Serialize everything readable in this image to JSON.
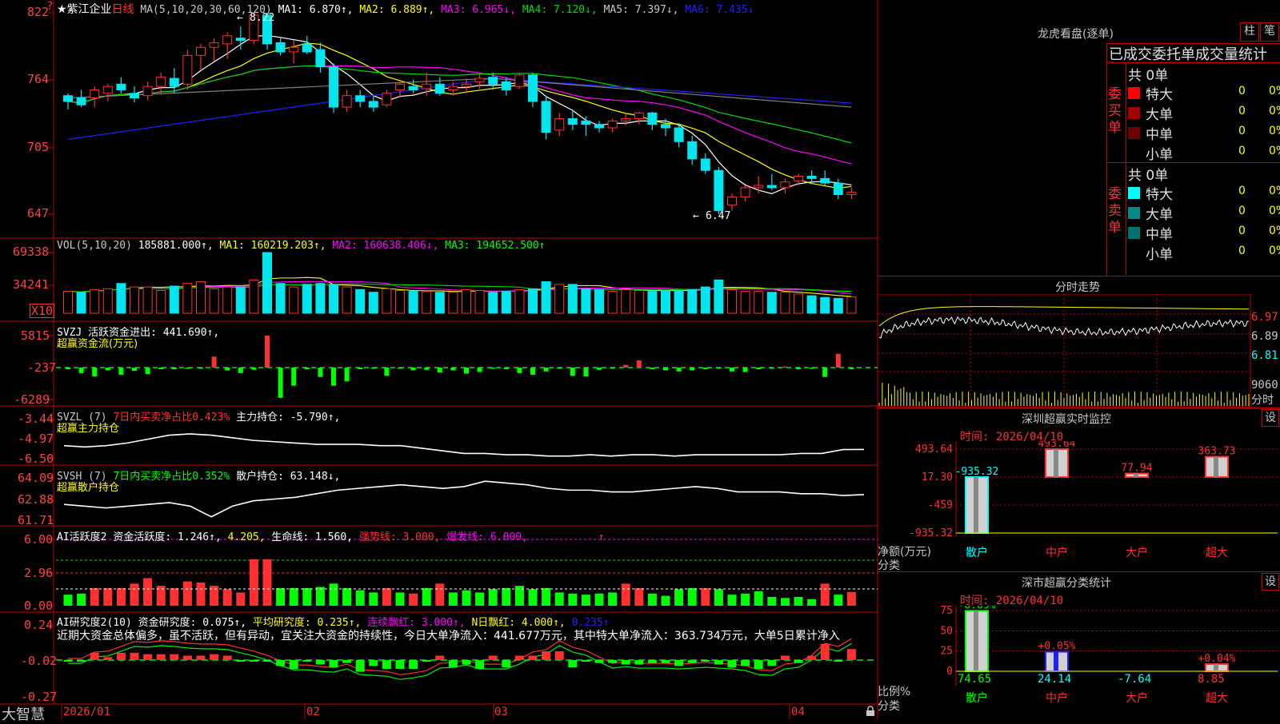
{
  "app": {
    "brand": "大智慧",
    "lock_icon": "lock-icon"
  },
  "colors": {
    "up": "#ff3030",
    "down": "#00e5ee",
    "frame": "#c00000",
    "ma1": "#ffffff",
    "ma2": "#ffff00",
    "ma3": "#ff00ff",
    "ma4": "#00dd00",
    "ma5": "#808080",
    "ma6": "#2020ff",
    "green": "#00ff00"
  },
  "price_panel": {
    "stock_name": "★紫江企业",
    "period": "日线",
    "ma_header": "MA(5,10,20,30,60,120)",
    "ma1": "MA1: 6.870↑,",
    "ma2": "MA2: 6.889↑,",
    "ma3": "MA3: 6.965↓,",
    "ma4": "MA4: 7.120↓,",
    "ma5": "MA5: 7.397↓,",
    "ma6": "MA6: 7.435↓",
    "y_ticks": [
      "822",
      "764",
      "705",
      "647"
    ],
    "high_label": "8.22",
    "low_label": "6.47",
    "marker": "?"
  },
  "vol_panel": {
    "header": "VOL(5,10,20)",
    "vol": "185881.000↑,",
    "ma1": "MA1: 160219.203↑,",
    "ma2": "MA2: 160638.406↓,",
    "ma3": "MA3: 194652.500↑",
    "y_ticks": [
      "69338",
      "34241"
    ],
    "unit": "X10"
  },
  "svzj_panel": {
    "header": "SVZJ  活跃资金进出: 441.690↑,",
    "sub": "超赢资金流(万元)",
    "y_ticks": [
      "5815",
      "-237",
      "-6289"
    ]
  },
  "svzl_panel": {
    "title": "SVZL (7)",
    "ratio": "7日内买卖净占比0.423%",
    "value": "主力持仓: -5.790↑,",
    "sub": "超赢主力持仓",
    "y_ticks": [
      "-3.44",
      "-4.97",
      "-6.50"
    ]
  },
  "svsh_panel": {
    "title": "SVSH (7)",
    "ratio": "7日内买卖净占比0.352%",
    "value": "散户持仓: 63.148↓,",
    "sub": "超赢散户持仓",
    "y_ticks": [
      "64.09",
      "62.88",
      "61.71"
    ]
  },
  "ai_active_panel": {
    "title": "AI活跃度2",
    "a1": "资金活跃度: 1.246↑,",
    "a2": "4.205,",
    "a3": "生命线: 1.560,",
    "a4": "强势线: 3.000,",
    "a5": "爆发线: 6.000,",
    "a6": "↑",
    "y_ticks": [
      "6.00",
      "2.96",
      "0.00"
    ]
  },
  "ai_research_panel": {
    "title": "AI研究度2(10)",
    "r1": "资金研究度: 0.075↑,",
    "r2": "平均研究度: 0.235↑,",
    "r3": "连续飘红: 3.000↑,",
    "r4": "N日飘红: 4.000↑,",
    "r5": "0.235↑",
    "commentary": "近期大资金总体偏多，虽不活跃，但有异动，宜关注大资金的持续性，今日大单净流入：441.677万元，其中特大单净流入：363.734万元，大单5日累计净入",
    "y_ticks": [
      "0.24",
      "-0.02",
      "-0.27"
    ]
  },
  "x_axis": {
    "labels": [
      "2026/01",
      "02",
      "03",
      "04"
    ]
  },
  "right_panel": {
    "title": "龙虎看盘(逐单)",
    "tab_bar": "柱",
    "tab_stroke": "笔",
    "stats_title": "已成交委托单成交量统计",
    "buy": {
      "side_label": [
        "委",
        "买",
        "单"
      ],
      "total": "共 0单",
      "rows": [
        {
          "label": "特大",
          "value": "0",
          "pct": "0%",
          "color": "#ff0000"
        },
        {
          "label": "大单",
          "value": "0",
          "pct": "0%",
          "color": "#a00000"
        },
        {
          "label": "中单",
          "value": "0",
          "pct": "0%",
          "color": "#700000"
        },
        {
          "label": "小单",
          "value": "0",
          "pct": "0%",
          "color": "#000000"
        }
      ]
    },
    "sell": {
      "side_label": [
        "委",
        "卖",
        "单"
      ],
      "total": "共 0单",
      "rows": [
        {
          "label": "特大",
          "value": "0",
          "pct": "0%",
          "color": "#00ffff"
        },
        {
          "label": "大单",
          "value": "0",
          "pct": "0%",
          "color": "#008b8b"
        },
        {
          "label": "中单",
          "value": "0",
          "pct": "0%",
          "color": "#007070"
        },
        {
          "label": "小单",
          "value": "0",
          "pct": "0%",
          "color": "#000000"
        }
      ]
    },
    "intraday": {
      "title": "分时走势",
      "prices": [
        "6.97",
        "6.89",
        "6.81"
      ],
      "vol_max": "9060",
      "vol_unit": "分时"
    },
    "monitor": {
      "title": "深圳超赢实时监控",
      "settings": "设",
      "time": "时间: 2026/04/10",
      "y_ticks": [
        "493.64",
        "17.30",
        "-459",
        "-935.32"
      ],
      "y_label1": "净额(万元)",
      "y_label2": "分类",
      "categories": [
        "散户",
        "中户",
        "大户",
        "超大"
      ],
      "values": [
        -935.32,
        493.64,
        77.94,
        363.73
      ],
      "value_labels": [
        "-935.32",
        "493.64",
        "77.94",
        "363.73"
      ]
    },
    "classify": {
      "title": "深市超赢分类统计",
      "settings": "设",
      "time": "时间: 2026/04/10",
      "y_ticks": [
        "75",
        "50",
        "25",
        "0"
      ],
      "y_label1": "比例%",
      "y_label2": "分类",
      "categories": [
        "散户",
        "中户",
        "大户",
        "超大"
      ],
      "values": [
        74.65,
        24.14,
        -7.64,
        8.85
      ],
      "changes": [
        "-0.09%",
        "+0.05%",
        "",
        "+0.04%"
      ],
      "value_labels": [
        "74.65",
        "24.14",
        "-7.64",
        "8.85"
      ]
    }
  },
  "chart_data": [
    {
      "type": "candlestick",
      "title": "★紫江企业 日线",
      "note": "daily OHLC (yuan), approximate read from chart; 60 sessions Jan–Apr 2026",
      "ylim": [
        6.4,
        8.3
      ],
      "ohlc": [
        [
          7.5,
          7.52,
          7.38,
          7.45
        ],
        [
          7.48,
          7.55,
          7.4,
          7.42
        ],
        [
          7.48,
          7.58,
          7.4,
          7.55
        ],
        [
          7.52,
          7.6,
          7.45,
          7.58
        ],
        [
          7.6,
          7.66,
          7.52,
          7.55
        ],
        [
          7.52,
          7.58,
          7.44,
          7.48
        ],
        [
          7.5,
          7.62,
          7.46,
          7.58
        ],
        [
          7.58,
          7.7,
          7.52,
          7.66
        ],
        [
          7.65,
          7.74,
          7.52,
          7.58
        ],
        [
          7.6,
          7.9,
          7.55,
          7.85
        ],
        [
          7.85,
          7.95,
          7.72,
          7.92
        ],
        [
          7.92,
          8.0,
          7.8,
          7.96
        ],
        [
          7.95,
          8.05,
          7.82,
          8.02
        ],
        [
          8.0,
          8.1,
          7.9,
          7.98
        ],
        [
          7.98,
          8.22,
          7.95,
          8.2
        ],
        [
          8.2,
          8.22,
          7.9,
          7.95
        ],
        [
          7.96,
          8.0,
          7.85,
          7.88
        ],
        [
          7.88,
          7.98,
          7.78,
          7.92
        ],
        [
          7.95,
          8.02,
          7.86,
          7.88
        ],
        [
          7.9,
          7.96,
          7.7,
          7.75
        ],
        [
          7.75,
          7.78,
          7.35,
          7.4
        ],
        [
          7.4,
          7.55,
          7.36,
          7.5
        ],
        [
          7.5,
          7.55,
          7.4,
          7.45
        ],
        [
          7.45,
          7.5,
          7.36,
          7.4
        ],
        [
          7.42,
          7.55,
          7.4,
          7.52
        ],
        [
          7.55,
          7.62,
          7.48,
          7.6
        ],
        [
          7.58,
          7.64,
          7.52,
          7.55
        ],
        [
          7.56,
          7.7,
          7.5,
          7.6
        ],
        [
          7.6,
          7.66,
          7.5,
          7.52
        ],
        [
          7.55,
          7.62,
          7.5,
          7.58
        ],
        [
          7.58,
          7.65,
          7.52,
          7.6
        ],
        [
          7.62,
          7.7,
          7.56,
          7.65
        ],
        [
          7.66,
          7.7,
          7.55,
          7.6
        ],
        [
          7.62,
          7.66,
          7.5,
          7.55
        ],
        [
          7.58,
          7.7,
          7.56,
          7.68
        ],
        [
          7.68,
          7.7,
          7.4,
          7.45
        ],
        [
          7.45,
          7.5,
          7.12,
          7.18
        ],
        [
          7.2,
          7.35,
          7.15,
          7.3
        ],
        [
          7.3,
          7.38,
          7.2,
          7.25
        ],
        [
          7.28,
          7.32,
          7.15,
          7.25
        ],
        [
          7.25,
          7.28,
          7.18,
          7.22
        ],
        [
          7.22,
          7.3,
          7.18,
          7.28
        ],
        [
          7.28,
          7.35,
          7.24,
          7.3
        ],
        [
          7.3,
          7.36,
          7.25,
          7.35
        ],
        [
          7.35,
          7.36,
          7.2,
          7.25
        ],
        [
          7.25,
          7.3,
          7.15,
          7.22
        ],
        [
          7.22,
          7.26,
          7.05,
          7.1
        ],
        [
          7.1,
          7.15,
          6.9,
          6.95
        ],
        [
          6.95,
          7.0,
          6.82,
          6.85
        ],
        [
          6.85,
          6.88,
          6.47,
          6.5
        ],
        [
          6.55,
          6.65,
          6.5,
          6.62
        ],
        [
          6.62,
          6.72,
          6.58,
          6.7
        ],
        [
          6.7,
          6.8,
          6.65,
          6.72
        ],
        [
          6.72,
          6.82,
          6.68,
          6.7
        ],
        [
          6.7,
          6.78,
          6.65,
          6.75
        ],
        [
          6.76,
          6.82,
          6.72,
          6.8
        ],
        [
          6.8,
          6.85,
          6.74,
          6.78
        ],
        [
          6.78,
          6.85,
          6.72,
          6.74
        ],
        [
          6.74,
          6.78,
          6.6,
          6.64
        ],
        [
          6.64,
          6.7,
          6.6,
          6.66
        ]
      ]
    },
    {
      "type": "bar",
      "title": "VOL(5,10,20)",
      "note": "volume in units of 10 (X10), approximate; direction per session",
      "ylim": [
        0,
        80000
      ],
      "values": [
        25000,
        24000,
        27000,
        28000,
        34000,
        30000,
        30000,
        26000,
        31000,
        34000,
        36000,
        28000,
        30000,
        30000,
        38000,
        69338,
        34000,
        30000,
        33000,
        34000,
        33000,
        30000,
        27000,
        24000,
        28000,
        26000,
        25000,
        25000,
        24000,
        24000,
        27000,
        26000,
        24000,
        25000,
        27000,
        28000,
        36000,
        33000,
        33000,
        28000,
        27000,
        25000,
        27000,
        26000,
        25000,
        26000,
        26000,
        27000,
        30000,
        38000,
        27000,
        25000,
        25000,
        24000,
        24000,
        22000,
        20000,
        18000,
        17000,
        18588
      ],
      "up": [
        true,
        false,
        true,
        true,
        false,
        true,
        true,
        true,
        false,
        true,
        true,
        true,
        true,
        false,
        true,
        false,
        false,
        true,
        false,
        false,
        false,
        true,
        false,
        false,
        true,
        true,
        false,
        true,
        false,
        true,
        true,
        true,
        false,
        false,
        true,
        false,
        false,
        true,
        false,
        false,
        false,
        true,
        true,
        true,
        false,
        false,
        false,
        false,
        false,
        false,
        true,
        true,
        true,
        false,
        true,
        true,
        false,
        false,
        false,
        true
      ]
    },
    {
      "type": "bar",
      "title": "SVZJ 超赢资金流(万元)",
      "note": "net active money flow per session (万元), approximate",
      "ylim": [
        -6289,
        5815
      ],
      "values": [
        -300,
        -1000,
        -1600,
        -500,
        -1300,
        -600,
        -1200,
        -300,
        -300,
        -200,
        -200,
        2000,
        -500,
        -1000,
        -400,
        5815,
        -5500,
        -3300,
        -300,
        -1700,
        -3300,
        -2500,
        -300,
        -200,
        -1500,
        -200,
        -500,
        -400,
        -900,
        -500,
        -1100,
        -800,
        -200,
        -300,
        -1000,
        -1300,
        -700,
        -200,
        -1500,
        -1600,
        -400,
        -200,
        500,
        1300,
        -300,
        -500,
        -700,
        -500,
        -300,
        -200,
        -700,
        -800,
        -300,
        -200,
        200,
        -300,
        -200,
        -1700,
        2500,
        -300
      ]
    },
    {
      "type": "line",
      "title": "SVZL 超赢主力持仓",
      "note": "main-force position line, approximate",
      "ylim": [
        -6.5,
        -3.44
      ],
      "values": [
        -5.5,
        -5.6,
        -5.5,
        -5.3,
        -5.0,
        -4.7,
        -4.6,
        -4.7,
        -4.9,
        -5.1,
        -5.2,
        -5.3,
        -5.4,
        -5.4,
        -5.4,
        -5.5,
        -5.5,
        -5.7,
        -5.9,
        -6.1,
        -6.1,
        -6.2,
        -6.2,
        -6.3,
        -6.3,
        -6.2,
        -6.3,
        -6.2,
        -6.2,
        -6.3,
        -6.2,
        -6.2,
        -6.2,
        -6.2,
        -6.2,
        -6.1,
        -6.1,
        -5.8,
        -5.79
      ]
    },
    {
      "type": "line",
      "title": "SVSH 超赢散户持仓",
      "note": "retail position line, approximate",
      "ylim": [
        61.71,
        64.09
      ],
      "values": [
        62.6,
        62.5,
        62.4,
        62.5,
        62.6,
        62.7,
        62.5,
        61.9,
        62.5,
        62.8,
        62.9,
        63.0,
        63.2,
        63.4,
        63.5,
        63.6,
        63.7,
        63.6,
        63.5,
        63.6,
        63.9,
        63.8,
        63.7,
        63.5,
        63.4,
        63.4,
        63.3,
        63.3,
        63.4,
        63.5,
        63.6,
        63.5,
        63.3,
        63.3,
        63.3,
        63.2,
        63.2,
        63.1,
        63.148
      ]
    },
    {
      "type": "bar",
      "title": "AI活跃度2",
      "note": "fund activity per session, approximate",
      "ylim": [
        0,
        6.0
      ],
      "values": [
        1.0,
        1.1,
        1.6,
        1.6,
        1.6,
        2.0,
        2.5,
        1.8,
        1.6,
        2.2,
        2.1,
        1.8,
        1.5,
        1.2,
        4.2,
        4.2,
        1.6,
        1.6,
        1.6,
        1.7,
        2.0,
        1.6,
        1.4,
        1.2,
        1.6,
        1.2,
        1.1,
        1.6,
        2.0,
        1.2,
        1.4,
        1.2,
        1.5,
        1.6,
        1.8,
        1.5,
        1.6,
        1.2,
        1.1,
        1.0,
        1.1,
        1.2,
        2.0,
        1.6,
        1.1,
        0.9,
        1.5,
        1.6,
        1.6,
        1.5,
        1.0,
        1.1,
        1.3,
        0.8,
        0.7,
        0.8,
        0.6,
        2.0,
        1.0,
        1.246
      ],
      "up": [
        false,
        false,
        true,
        true,
        true,
        true,
        true,
        true,
        true,
        true,
        true,
        true,
        true,
        true,
        true,
        true,
        false,
        false,
        false,
        false,
        false,
        false,
        false,
        false,
        true,
        false,
        true,
        false,
        true,
        false,
        false,
        false,
        false,
        false,
        false,
        false,
        false,
        false,
        false,
        false,
        false,
        false,
        true,
        true,
        false,
        false,
        false,
        false,
        true,
        false,
        false,
        false,
        false,
        false,
        false,
        false,
        false,
        true,
        false,
        true
      ],
      "thresholds": {
        "强势线": 3.0,
        "爆发线": 6.0,
        "生命线": 1.56
      }
    },
    {
      "type": "bar",
      "title": "AI研究度2(10)",
      "note": "fund research degree per session, approximate",
      "ylim": [
        -0.27,
        0.24
      ],
      "values": [
        -0.01,
        -0.01,
        0.05,
        0.02,
        0.05,
        0.05,
        0.04,
        0.04,
        0.04,
        0.03,
        0.03,
        0.04,
        0.03,
        -0.01,
        -0.01,
        -0.01,
        -0.04,
        -0.06,
        -0.01,
        -0.03,
        -0.05,
        -0.02,
        -0.08,
        -0.04,
        -0.06,
        -0.06,
        -0.06,
        -0.01,
        0.03,
        -0.05,
        -0.03,
        -0.06,
        0.03,
        -0.05,
        0.03,
        0.03,
        0.06,
        0.06,
        -0.05,
        -0.01,
        -0.02,
        -0.02,
        -0.03,
        -0.03,
        -0.02,
        -0.02,
        -0.04,
        -0.02,
        -0.01,
        -0.03,
        -0.05,
        -0.04,
        -0.06,
        -0.04,
        0.03,
        -0.02,
        0.03,
        0.11,
        -0.01,
        0.075
      ]
    }
  ]
}
